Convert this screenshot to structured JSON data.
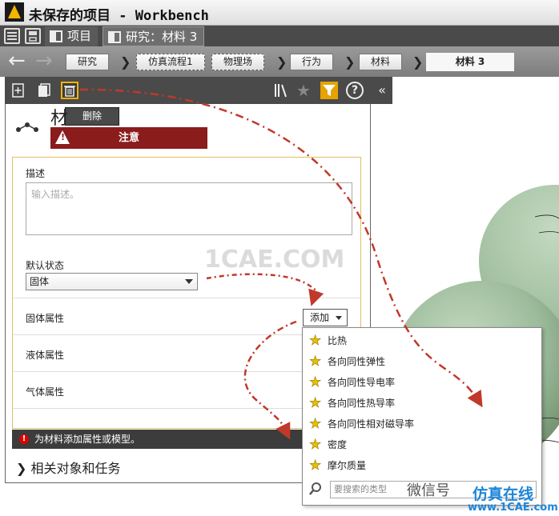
{
  "window": {
    "title": "未保存的项目 - Workbench"
  },
  "tabs": [
    {
      "label": "项目"
    },
    {
      "label": "研究：材料 3"
    }
  ],
  "breadcrumb": {
    "items": [
      "研究",
      "仿真流程1",
      "物理场",
      "行为",
      "材料"
    ],
    "current": "材料 3"
  },
  "panel": {
    "tooltip_delete": "删除",
    "title": "材",
    "notice": "注意",
    "description_label": "描述",
    "description_placeholder": "输入描述。",
    "default_state_label": "默认状态",
    "default_state_value": "固体",
    "solid_properties_label": "固体属性",
    "liquid_properties_label": "液体属性",
    "gas_properties_label": "气体属性",
    "add_button_label": "添加",
    "status_message": "为材料添加属性或模型。",
    "related_section_label": "相关对象和任务"
  },
  "add_menu": {
    "items": [
      "比热",
      "各向同性弹性",
      "各向同性导电率",
      "各向同性热导率",
      "各向同性相对磁导率",
      "密度",
      "摩尔质量"
    ],
    "search_placeholder": "要搜索的类型"
  },
  "watermarks": {
    "center": "1CAE.COM",
    "wechat": "微信号",
    "brand": "仿真在线",
    "url": "www.1CAE.com"
  },
  "colors": {
    "notice": "#8b1c1c",
    "accent": "#e6a300",
    "sphere": "#9dbc9b",
    "annotation_arrow": "#c0392b"
  }
}
